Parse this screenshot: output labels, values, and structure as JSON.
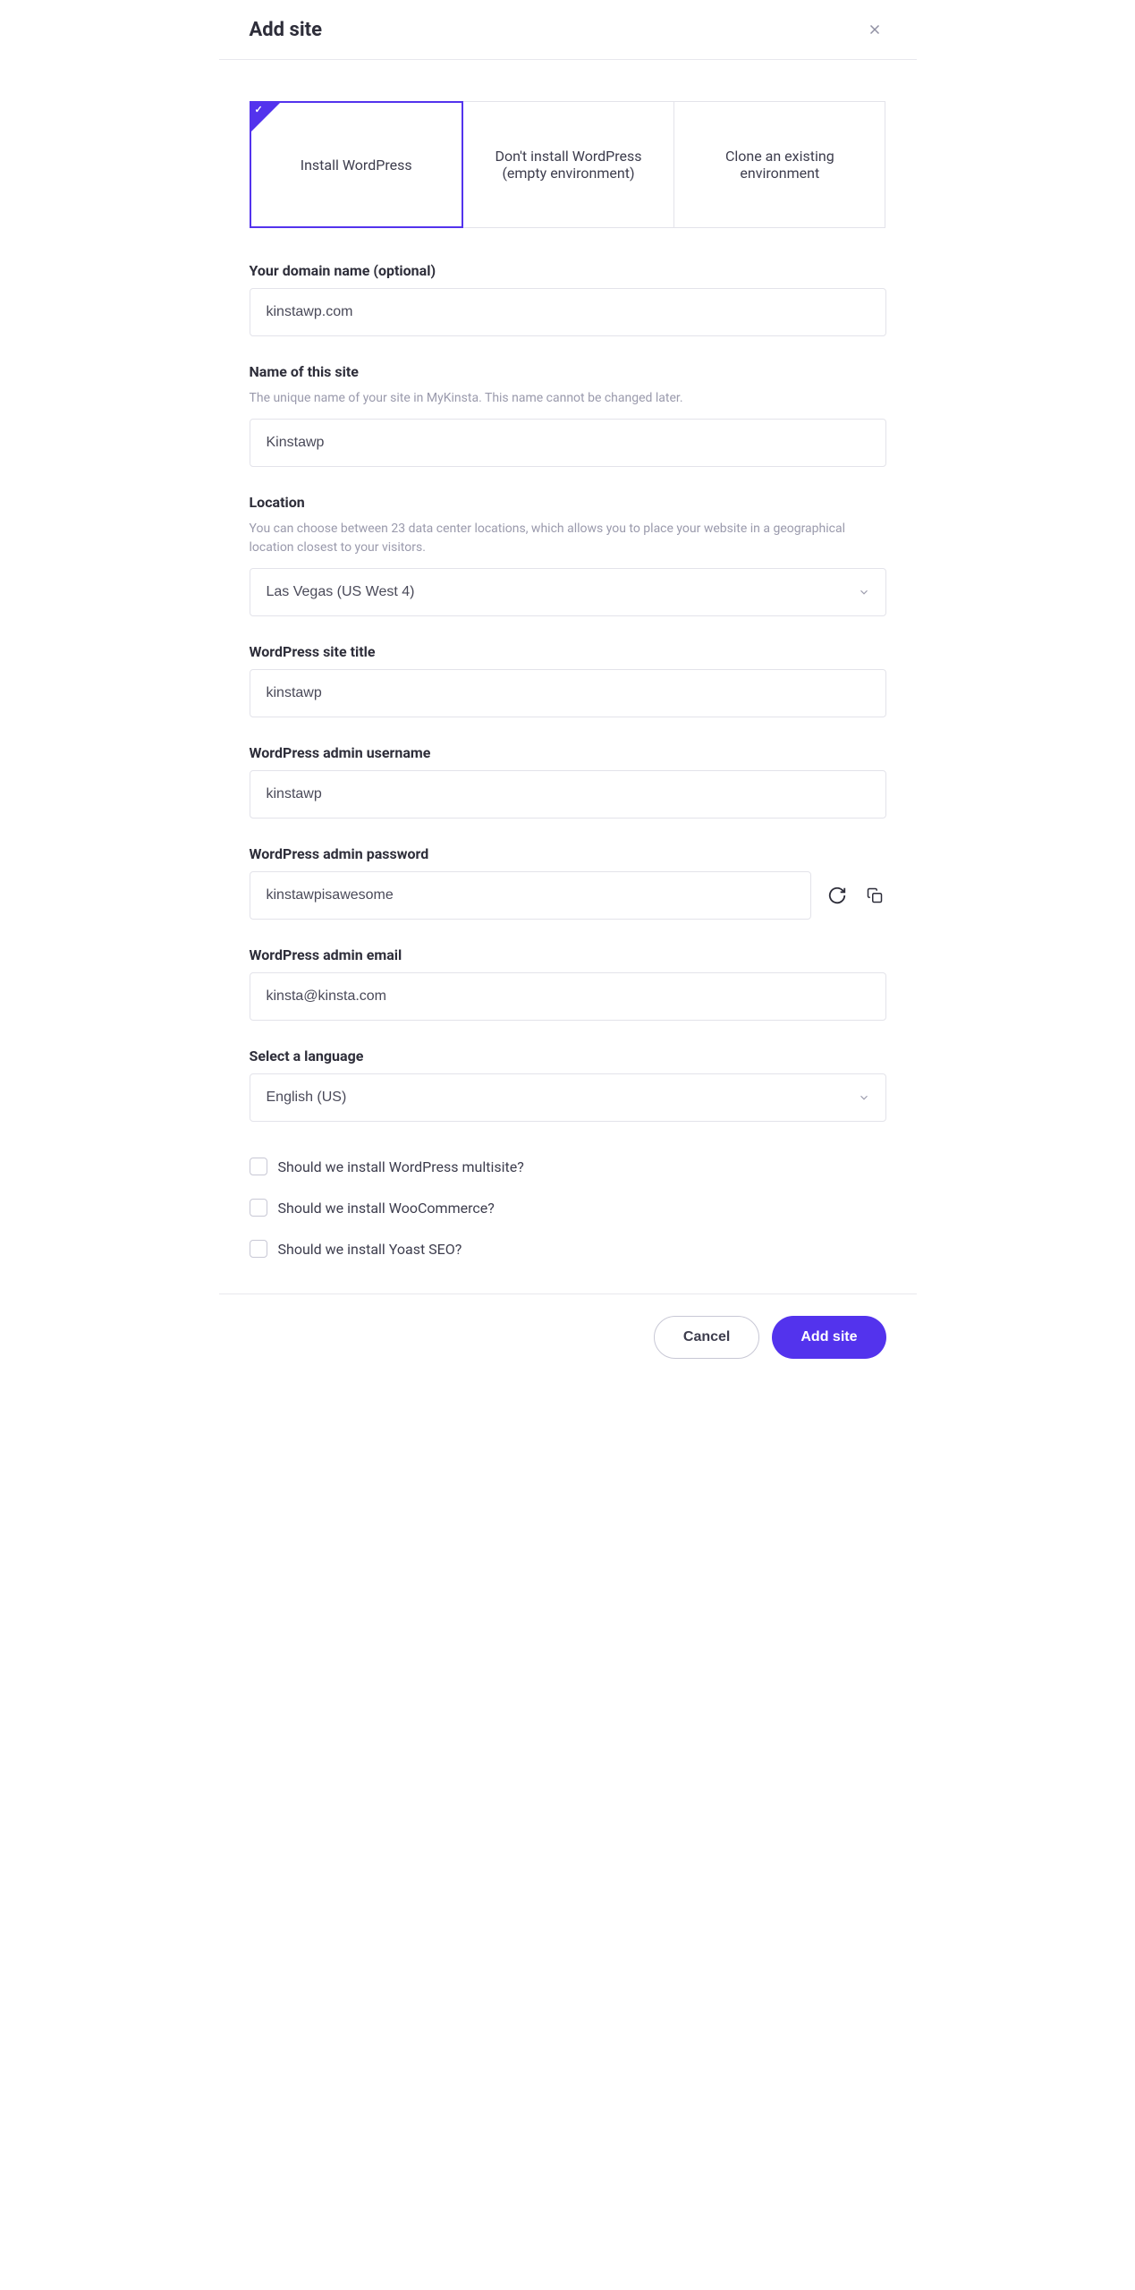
{
  "header": {
    "title": "Add site"
  },
  "options": {
    "install": "Install WordPress",
    "empty": "Don't install WordPress (empty environment)",
    "clone": "Clone an existing environment"
  },
  "fields": {
    "domain": {
      "label": "Your domain name (optional)",
      "value": "kinstawp.com"
    },
    "siteName": {
      "label": "Name of this site",
      "hint": "The unique name of your site in MyKinsta. This name cannot be changed later.",
      "value": "Kinstawp"
    },
    "location": {
      "label": "Location",
      "hint": "You can choose between 23 data center locations, which allows you to place your website in a geographical location closest to your visitors.",
      "value": "Las Vegas (US West 4)"
    },
    "siteTitle": {
      "label": "WordPress site title",
      "value": "kinstawp"
    },
    "adminUsername": {
      "label": "WordPress admin username",
      "value": "kinstawp"
    },
    "adminPassword": {
      "label": "WordPress admin password",
      "value": "kinstawpisawesome"
    },
    "adminEmail": {
      "label": "WordPress admin email",
      "value": "kinsta@kinsta.com"
    },
    "language": {
      "label": "Select a language",
      "value": "English (US)"
    }
  },
  "checkboxes": {
    "multisite": "Should we install WordPress multisite?",
    "woocommerce": "Should we install WooCommerce?",
    "yoast": "Should we install Yoast SEO?"
  },
  "footer": {
    "cancel": "Cancel",
    "submit": "Add site"
  }
}
